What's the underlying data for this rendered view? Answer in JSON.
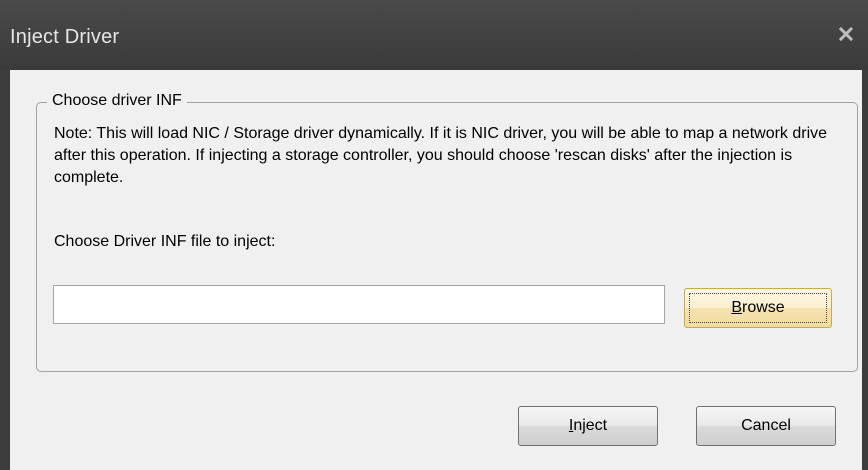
{
  "window": {
    "title": "Inject Driver"
  },
  "group": {
    "legend": "Choose driver INF",
    "note": "Note: This will load NIC / Storage driver dynamically. If it is NIC driver, you will be able to map a network drive after this operation. If injecting a storage controller, you should choose 'rescan disks' after the injection is complete.",
    "file_label": "Choose Driver INF file to inject:",
    "path_value": "",
    "browse": {
      "accel": "B",
      "rest": "rowse"
    }
  },
  "buttons": {
    "inject": {
      "accel": "I",
      "rest": "nject"
    },
    "cancel": "Cancel"
  },
  "icons": {
    "close": "close-icon"
  }
}
